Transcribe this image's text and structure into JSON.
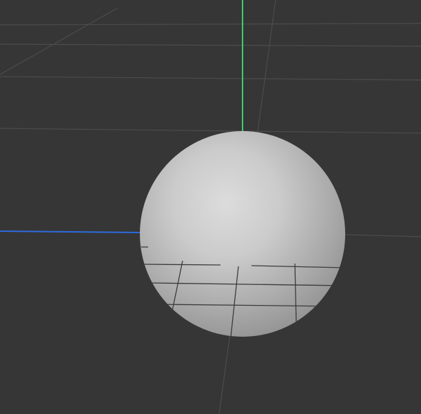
{
  "viewport": {
    "background": "#363636",
    "grid_color": "#4a4a4a",
    "y_axis_color": "#3ecf6a",
    "z_axis_color": "#2d6be0"
  },
  "scene": {
    "object": "sphere",
    "object_color": "#d6d6d6"
  }
}
